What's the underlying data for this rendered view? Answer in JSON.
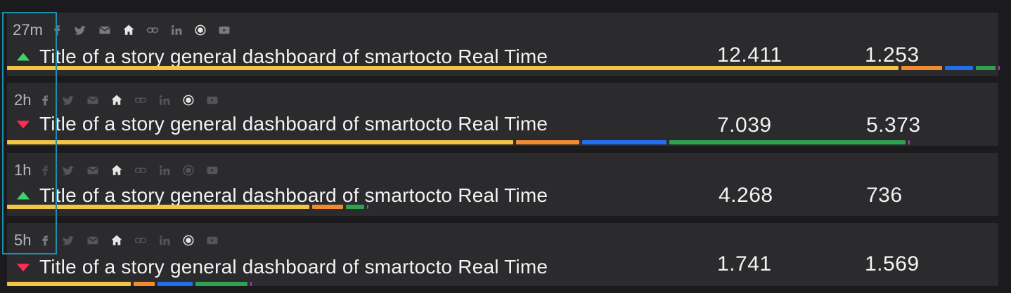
{
  "rows": [
    {
      "time": "27m",
      "trend": "up",
      "title": "Title of a story general dashboard of smartocto Real Time",
      "metric1": "12.411",
      "metric2": "1.253"
    },
    {
      "time": "2h",
      "trend": "down",
      "title": "Title of a story general dashboard of smartocto Real Time",
      "metric1": "7.039",
      "metric2": "5.373"
    },
    {
      "time": "1h",
      "trend": "up",
      "title": "Title of a story general dashboard of smartocto Real Time",
      "metric1": "4.268",
      "metric2": "736"
    },
    {
      "time": "5h",
      "trend": "down",
      "title": "Title of a story general dashboard of smartocto Real Time",
      "metric1": "1.741",
      "metric2": "1.569"
    }
  ],
  "share_icons": [
    "facebook-icon",
    "twitter-icon",
    "mail-icon",
    "home-icon",
    "link-icon",
    "linkedin-icon",
    "circle-icon",
    "youtube-icon"
  ],
  "colors": {
    "up": "#3bd36c",
    "down": "#ff2b55",
    "bar_yellow": "#f4c443",
    "bar_orange": "#f28b2f",
    "bar_blue": "#1f6ff0",
    "bar_green": "#2ea24e",
    "highlight": "#1f8fb0"
  }
}
